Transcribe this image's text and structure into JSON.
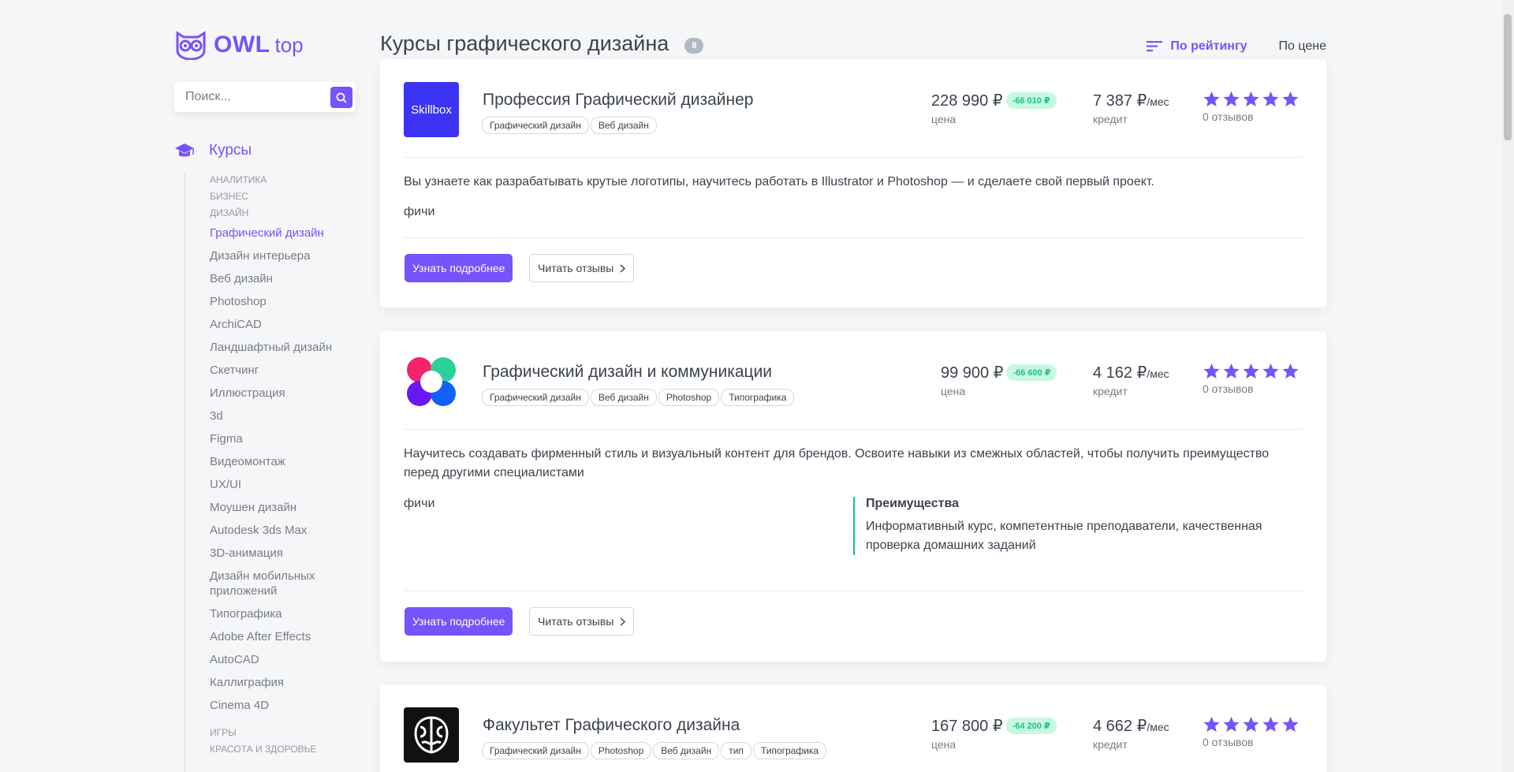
{
  "brand": {
    "name": "OWL",
    "suffix": "top"
  },
  "search": {
    "placeholder": "Поиск..."
  },
  "nav": {
    "top_label": "Курсы",
    "categories_before": [
      "Аналитика",
      "Бизнес",
      "Дизайн"
    ],
    "design_items": [
      "Графический дизайн",
      "Дизайн интерьера",
      "Веб дизайн",
      "Photoshop",
      "ArchiCAD",
      "Ландшафтный дизайн",
      "Скетчинг",
      "Иллюстрация",
      "3d",
      "Figma",
      "Видеомонтаж",
      "UX/UI",
      "Моушен дизайн",
      "Autodesk 3ds Max",
      "3D-анимация",
      "Дизайн мобильных приложений",
      "Типографика",
      "Adobe After Effects",
      "AutoCAD",
      "Каллиграфия",
      "Cinema 4D"
    ],
    "active_item": "Графический дизайн",
    "categories_after": [
      "Игры",
      "Красота и здоровье"
    ]
  },
  "page": {
    "title": "Курсы графического дизайна",
    "count": "8",
    "sort_by_rating": "По рейтингу",
    "sort_by_price": "По цене"
  },
  "courses": [
    {
      "title": "Профессия Графический дизайнер",
      "logo": "skillbox-logo",
      "logo_text": "Skillbox",
      "tags": [
        "Графический дизайн",
        "Веб дизайн"
      ],
      "price": "228 990 ₽",
      "discount": "-66 010 ₽",
      "price_label": "цена",
      "credit": "7 387 ₽",
      "credit_unit": "/мес",
      "credit_label": "кредит",
      "rating_stars": 5,
      "reviews": "0 отзывов",
      "description": "Вы узнаете как разрабатывать крутые логотипы, научитесь работать в Illustrator и Photoshop — и сделаете свой первый проект.",
      "features": "фичи",
      "more_button": "Узнать подробнее",
      "reviews_button": "Читать отзывы"
    },
    {
      "title": "Графический дизайн и коммуникации",
      "logo": "flower-logo",
      "tags": [
        "Графический дизайн",
        "Веб дизайн",
        "Photoshop",
        "Типографика"
      ],
      "price": "99 900 ₽",
      "discount": "-66 600 ₽",
      "price_label": "цена",
      "credit": "4 162 ₽",
      "credit_unit": "/мес",
      "credit_label": "кредит",
      "rating_stars": 5,
      "reviews": "0 отзывов",
      "description": "Научитесь создавать фирменный стиль и визуальный контент для брендов. Освоите навыки из смежных областей, чтобы получить преимущество перед другими специалистами",
      "features": "фичи",
      "advantages_title": "Преимущества",
      "advantages_text": "Информативный курс, компетентные преподаватели, качественная проверка домашних заданий",
      "more_button": "Узнать подробнее",
      "reviews_button": "Читать отзывы"
    },
    {
      "title": "Факультет Графического дизайна",
      "logo": "brain-logo",
      "tags": [
        "Графический дизайн",
        "Photoshop",
        "Веб дизайн",
        "тип",
        "Типографика"
      ],
      "price": "167 800 ₽",
      "discount": "-64 200 ₽",
      "price_label": "цена",
      "credit": "4 662 ₽",
      "credit_unit": "/мес",
      "credit_label": "кредит",
      "rating_stars": 5,
      "reviews": "0 отзывов"
    }
  ],
  "colors": {
    "accent": "#7653fc",
    "discount_bg": "#c8f8e4",
    "discount_text": "#1dc37e",
    "advantage_border": "#1dc37e"
  }
}
